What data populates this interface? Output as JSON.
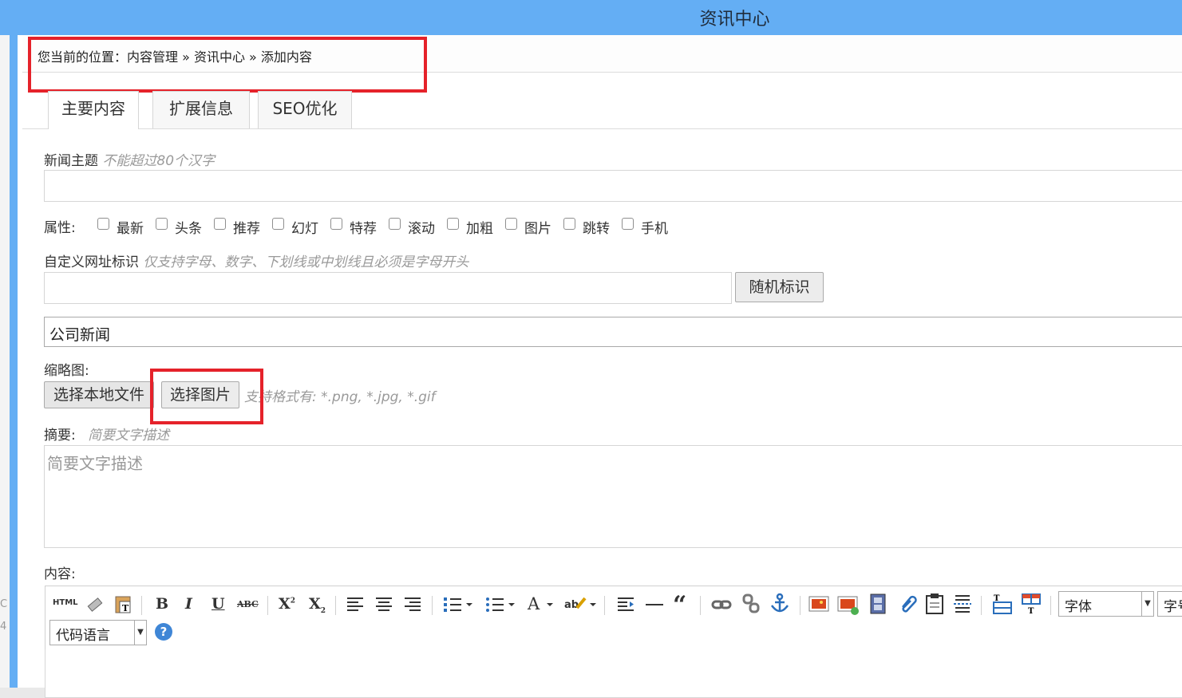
{
  "window": {
    "title": "资讯中心"
  },
  "left_fragment": {
    "a": "C",
    "b": "4"
  },
  "breadcrumb": {
    "text": "您当前的位置：内容管理 » 资讯中心 » 添加内容"
  },
  "tabs": [
    {
      "label": "主要内容"
    },
    {
      "label": "扩展信息"
    },
    {
      "label": "SEO优化"
    }
  ],
  "form": {
    "title_label": "新闻主题",
    "title_hint": "不能超过80个汉字",
    "title_value": "",
    "attr_label": "属性:",
    "attributes": [
      "最新",
      "头条",
      "推荐",
      "幻灯",
      "特荐",
      "滚动",
      "加粗",
      "图片",
      "跳转",
      "手机"
    ],
    "url_label": "自定义网址标识",
    "url_hint": "仅支持字母、数字、下划线或中划线且必须是字母开头",
    "url_value": "",
    "random_button": "随机标识",
    "category_value": "公司新闻",
    "thumb_label": "缩略图:",
    "local_file_button": "选择本地文件",
    "choose_image_button": "选择图片",
    "thumb_hint": "支持格式有: *.png, *.jpg, *.gif",
    "summary_label": "摘要:",
    "summary_hint": "简要文字描述",
    "summary_placeholder": "简要文字描述",
    "content_label": "内容:"
  },
  "editor": {
    "html_label": "HTML",
    "font_select": "字体",
    "size_select": "字号",
    "code_select": "代码语言",
    "help_glyph": "?",
    "accent": "#64aef4",
    "highlight": "#e5222a"
  }
}
